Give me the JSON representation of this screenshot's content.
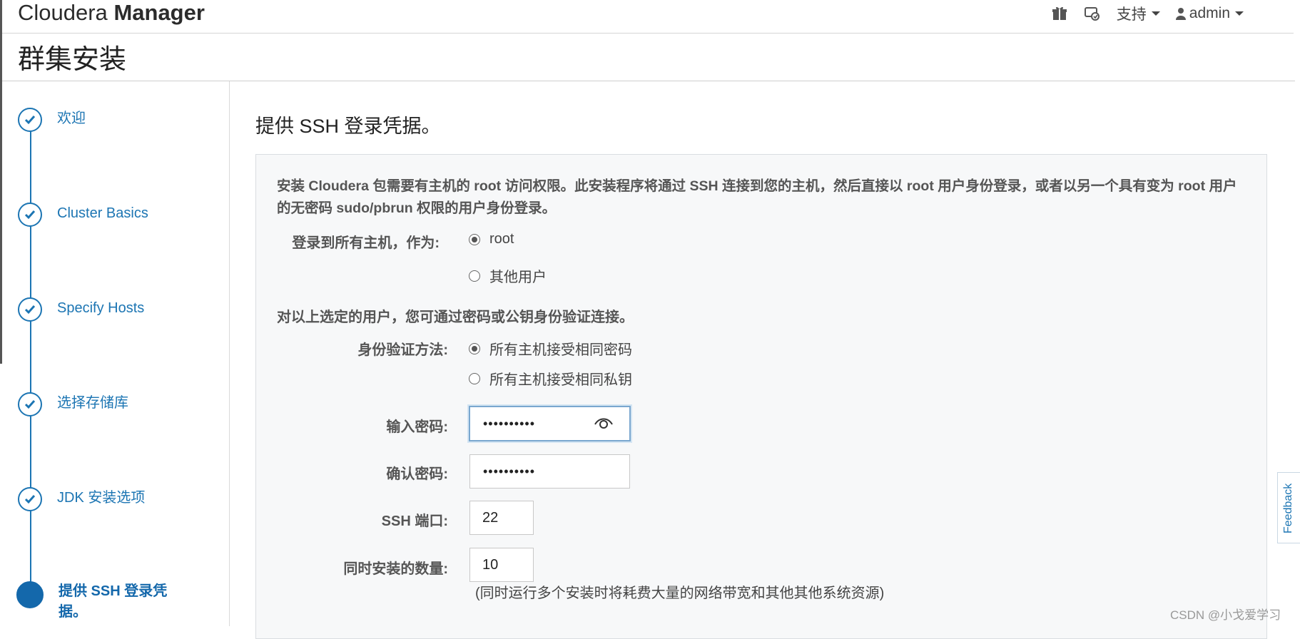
{
  "header": {
    "brand_light": "Cloudera",
    "brand_bold": "Manager",
    "support_label": "支持",
    "user_label": "admin",
    "icons": [
      "gift-icon",
      "tasks-icon",
      "user-icon"
    ]
  },
  "page": {
    "title": "群集安装"
  },
  "sidebar": {
    "steps": [
      {
        "label": "欢迎",
        "state": "done"
      },
      {
        "label": "Cluster Basics",
        "state": "done"
      },
      {
        "label": "Specify Hosts",
        "state": "done"
      },
      {
        "label": "选择存储库",
        "state": "done"
      },
      {
        "label": "JDK 安装选项",
        "state": "done"
      },
      {
        "label": "提供 SSH 登录凭据。",
        "state": "active"
      }
    ]
  },
  "main": {
    "heading": "提供 SSH 登录凭据。",
    "intro": "安装 Cloudera 包需要有主机的 root 访问权限。此安装程序将通过 SSH 连接到您的主机，然后直接以 root 用户身份登录，或者以另一个具有变为 root 用户的无密码 sudo/pbrun 权限的用户身份登录。",
    "login_as_label": "登录到所有主机，作为:",
    "login_options": [
      {
        "label": "root",
        "selected": true
      },
      {
        "label": "其他用户",
        "selected": false
      }
    ],
    "auth_section": "对以上选定的用户，您可通过密码或公钥身份验证连接。",
    "auth_method_label": "身份验证方法:",
    "auth_options": [
      {
        "label": "所有主机接受相同密码",
        "selected": true
      },
      {
        "label": "所有主机接受相同私钥",
        "selected": false
      }
    ],
    "password_label": "输入密码:",
    "password_value": "••••••••••",
    "confirm_label": "确认密码:",
    "confirm_value": "••••••••••",
    "ssh_port_label": "SSH 端口:",
    "ssh_port_value": "22",
    "concurrency_label": "同时安装的数量:",
    "concurrency_value": "10",
    "concurrency_note": "(同时运行多个安装时将耗费大量的网络带宽和其他其他系统资源)"
  },
  "feedback_label": "Feedback",
  "watermark": "CSDN @小戈爱学习",
  "colors": {
    "accent": "#1c75b3",
    "active": "#1468ab"
  }
}
